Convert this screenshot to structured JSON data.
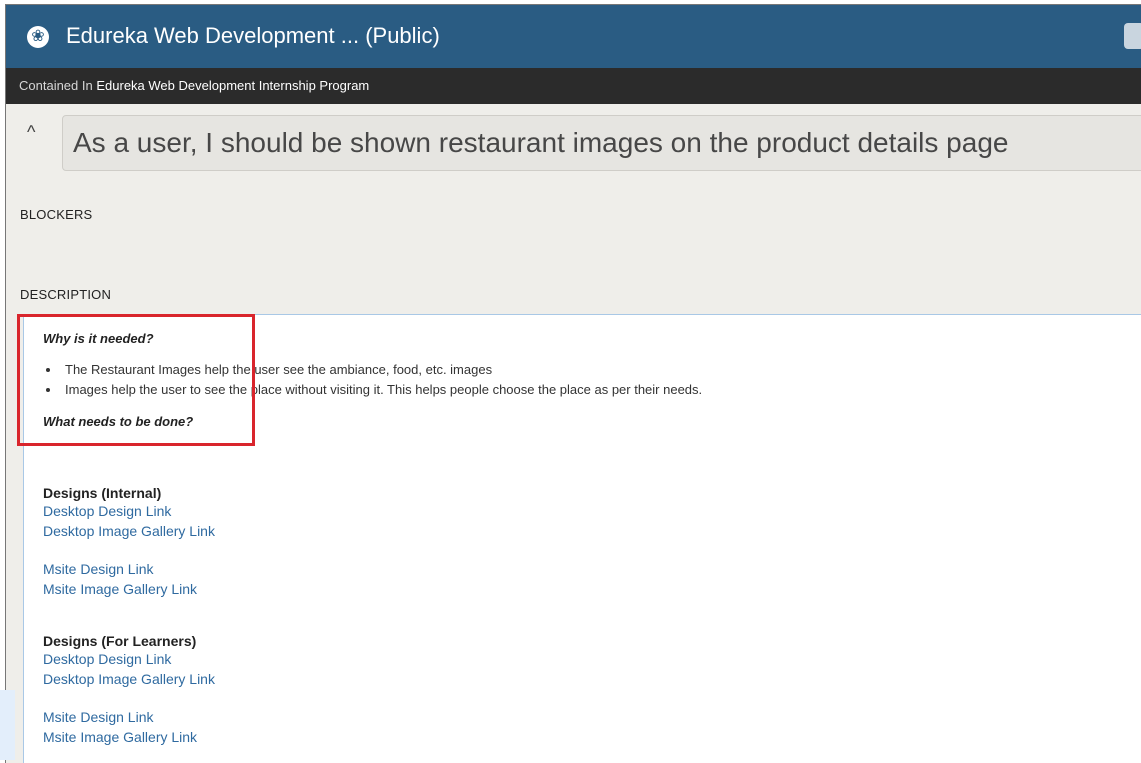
{
  "window": {
    "title": "Edureka Web Development ... (Public)"
  },
  "breadcrumb": {
    "prefix": "Contained In",
    "project": "Edureka Web Development Internship Program"
  },
  "story": {
    "title": "As a user, I should be shown restaurant images on the product details page"
  },
  "sections": {
    "blockers": "BLOCKERS",
    "description": "DESCRIPTION"
  },
  "description": {
    "why_heading": "Why is it needed?",
    "bullets": [
      "The Restaurant Images help the user see the ambiance, food, etc. images",
      "Images help the user to see the place without visiting it. This helps people choose the place as per their needs."
    ],
    "what_heading": "What needs to be done?",
    "internal": {
      "heading": "Designs (Internal)",
      "links": [
        "Desktop Design Link",
        "Desktop Image Gallery Link",
        "Msite Design Link",
        "Msite Image Gallery Link"
      ]
    },
    "learners": {
      "heading": "Designs (For Learners)",
      "links": [
        "Desktop Design Link",
        "Desktop Image Gallery Link",
        "Msite Design Link",
        "Msite Image Gallery Link"
      ]
    }
  },
  "icons": {
    "logo": "edureka-logo-icon",
    "collapse": "chevron-up-icon"
  },
  "colors": {
    "titlebar": "#2a5c83",
    "breadcrumb_bar": "#2b2b2b",
    "link": "#2f6aa0",
    "highlight": "#d9252c"
  }
}
